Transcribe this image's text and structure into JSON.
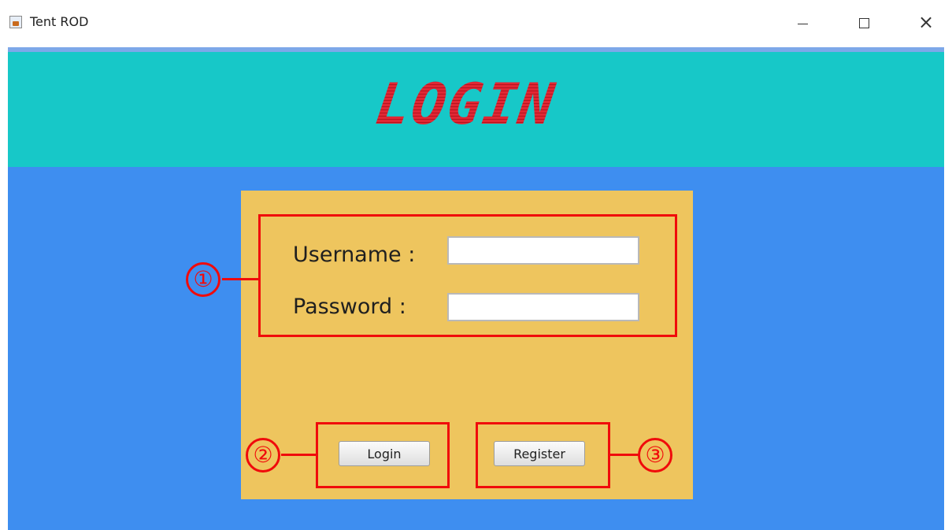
{
  "window": {
    "title": "Tent ROD",
    "icon": "java-app-icon",
    "controls": {
      "minimize_icon": "minimize-icon",
      "maximize_icon": "maximize-icon",
      "close_icon": "close-icon",
      "close_glyph": "×"
    }
  },
  "header": {
    "title": "LOGIN",
    "background_color": "#17c8c8",
    "title_color": "#d91e2a"
  },
  "form": {
    "background_color": "#eec55e",
    "username_label": "Username :",
    "username_value": "",
    "password_label": "Password :",
    "password_value": "",
    "login_button": "Login",
    "register_button": "Register"
  },
  "annotations": [
    {
      "number": "①"
    },
    {
      "number": "②"
    },
    {
      "number": "③"
    }
  ],
  "colors": {
    "frame_background": "#3e8ef0",
    "annotation": "#f00b0b"
  }
}
